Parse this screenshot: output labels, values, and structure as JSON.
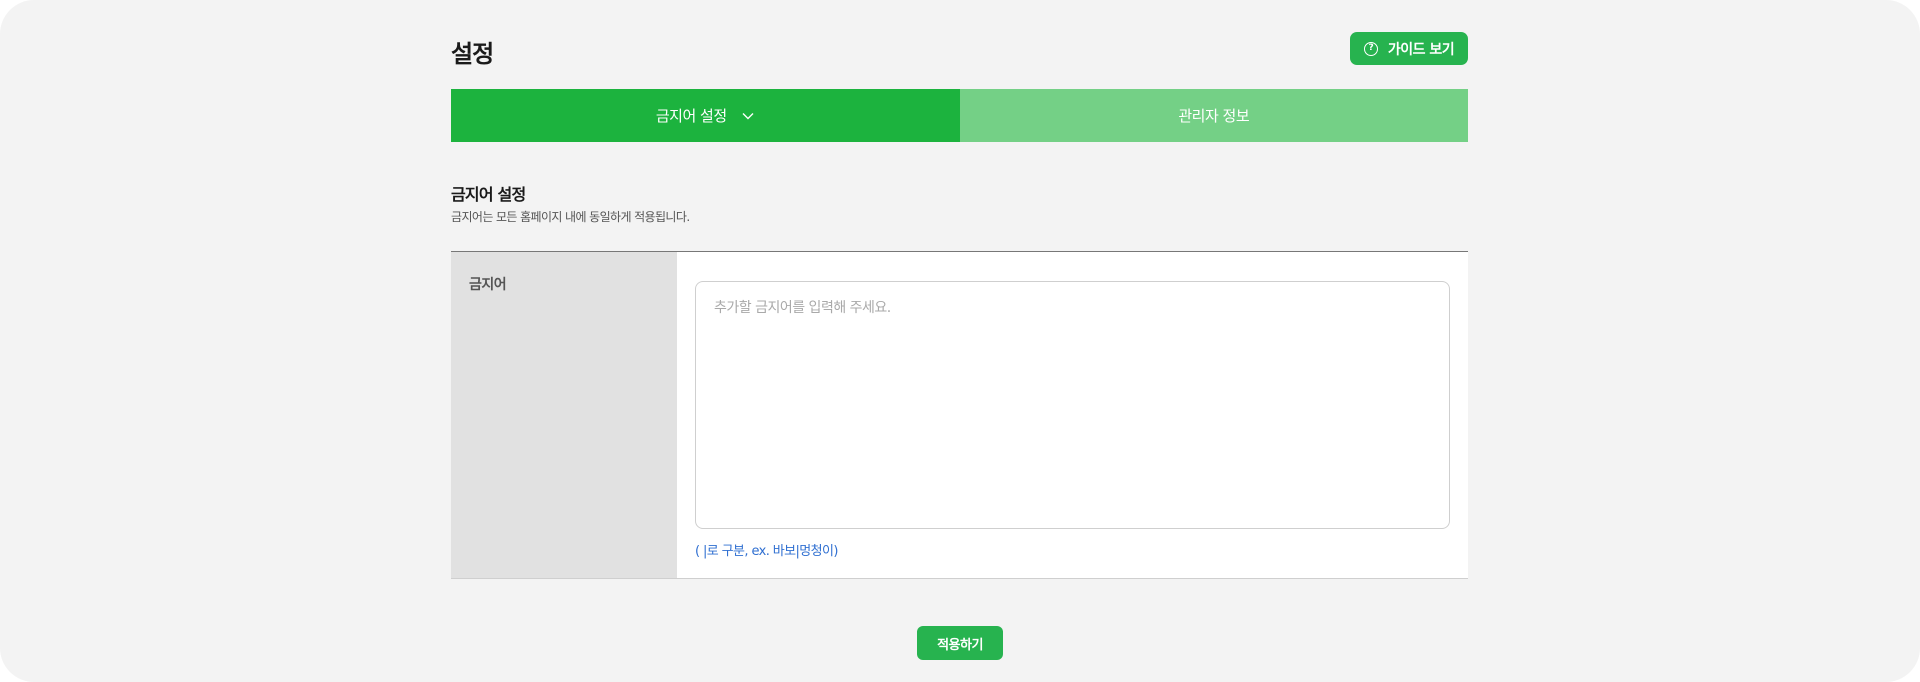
{
  "header": {
    "title": "설정",
    "guide_button_label": "가이드 보기"
  },
  "tabs": [
    {
      "label": "금지어 설정",
      "active": true
    },
    {
      "label": "관리자 정보",
      "active": false
    }
  ],
  "section": {
    "title": "금지어 설정",
    "description": "금지어는 모든 홈페이지 내에 동일하게 적용됩니다."
  },
  "form": {
    "field_label": "금지어",
    "textarea_placeholder": "추가할 금지어를 입력해 주세요.",
    "textarea_value": "",
    "hint": "( |로 구분, ex. 바보|멍청이)"
  },
  "footer": {
    "apply_label": "적용하기"
  },
  "colors": {
    "accent": "#1cb33e",
    "tab_inactive": "#74d086",
    "hint": "#2f6fd1"
  }
}
